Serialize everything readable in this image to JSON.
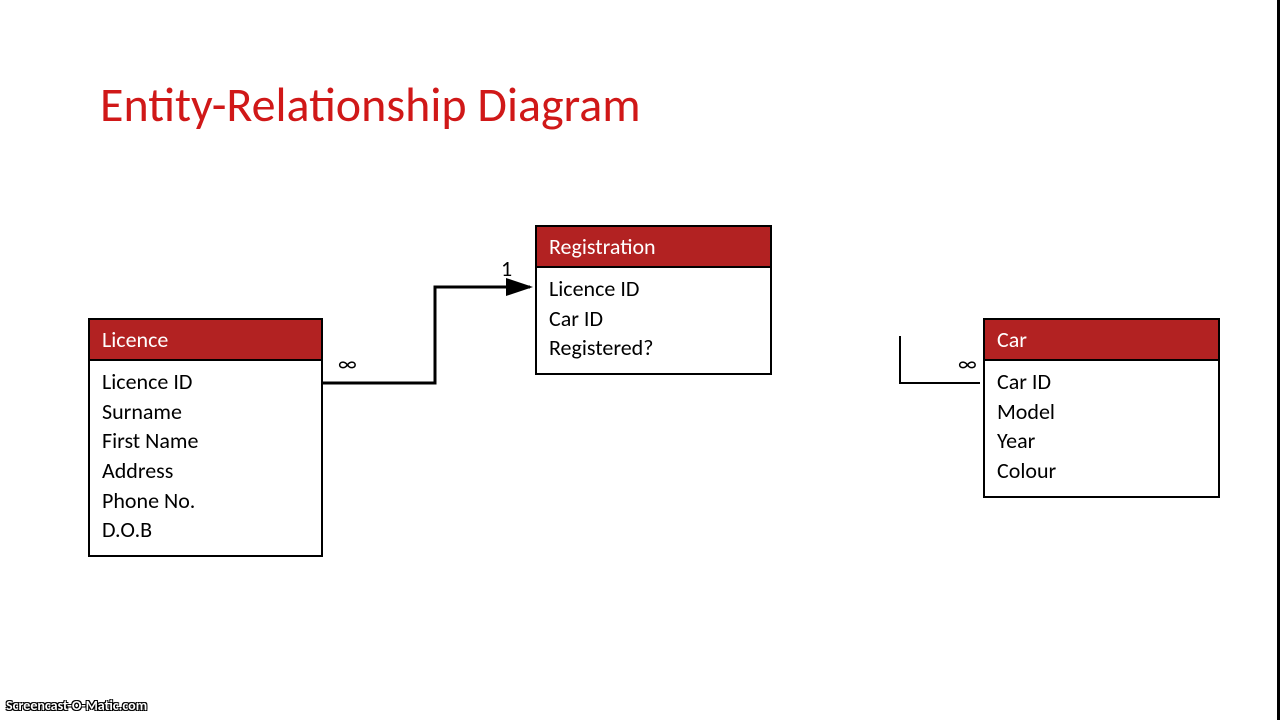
{
  "title": "Entity-Relationship Diagram",
  "entities": {
    "licence": {
      "name": "Licence",
      "attrs": [
        "Licence ID",
        "Surname",
        "First Name",
        "Address",
        "Phone No.",
        "D.O.B"
      ]
    },
    "registration": {
      "name": "Registration",
      "attrs": [
        "Licence ID",
        "Car ID",
        "Registered?"
      ]
    },
    "car": {
      "name": "Car",
      "attrs": [
        "Car ID",
        "Model",
        "Year",
        "Colour"
      ]
    }
  },
  "cardinalities": {
    "licence_side": "∞",
    "registration_side": "1",
    "car_side": "∞"
  },
  "watermark": "Screencast-O-Matic.com"
}
